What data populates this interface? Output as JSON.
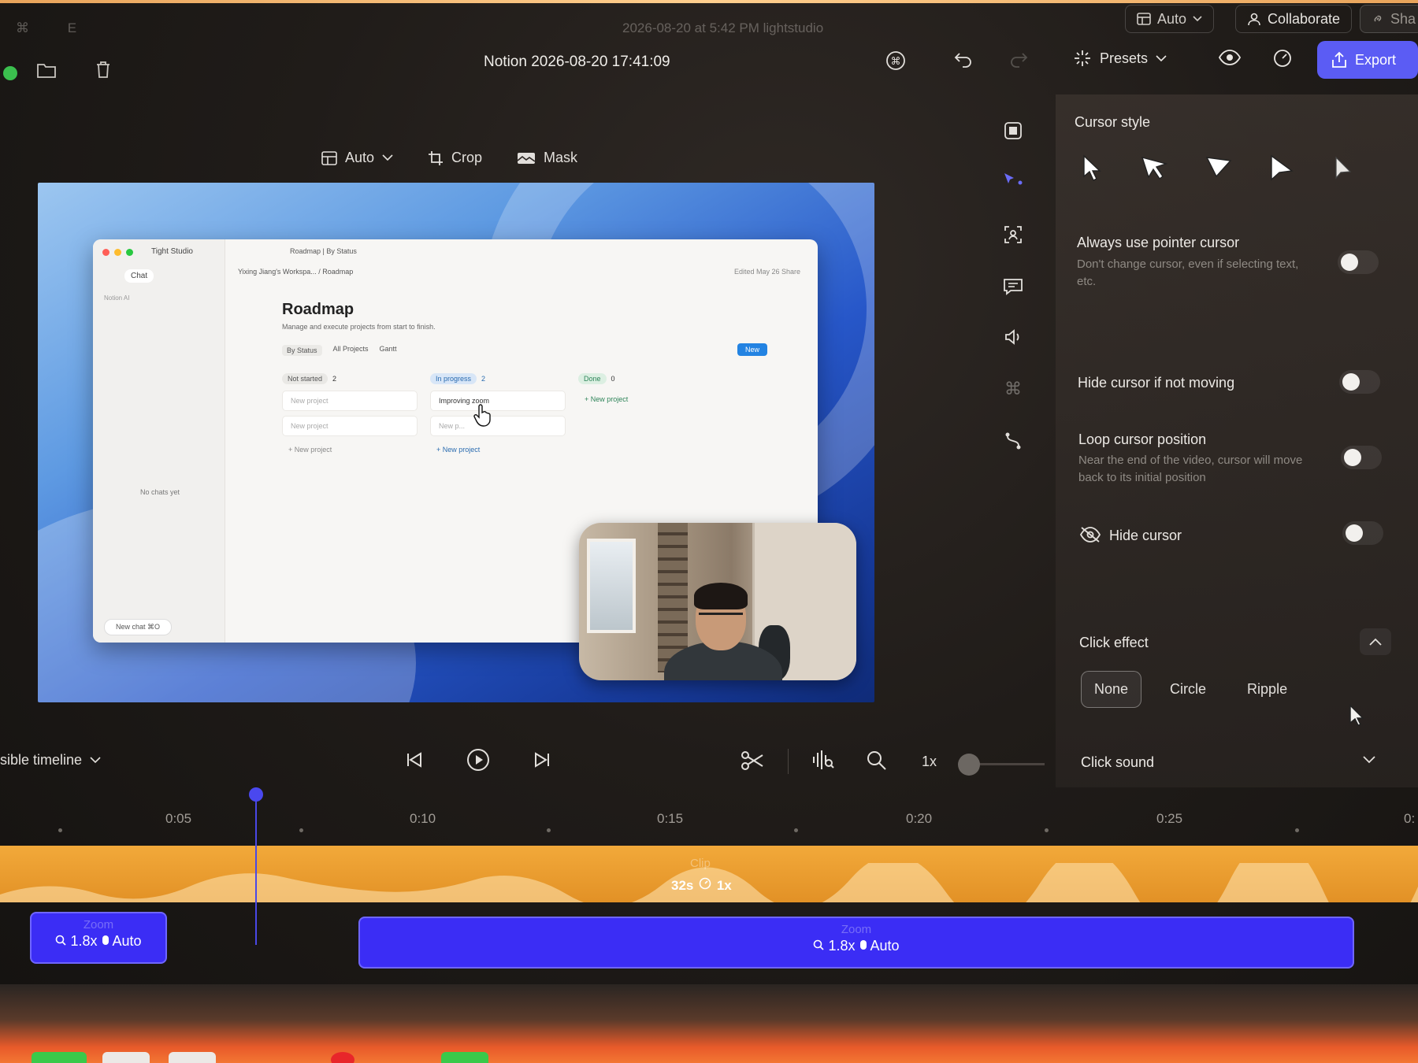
{
  "ghost_bar": {
    "date": "2026-08-20 at 5:42 PM lightstudio",
    "keys": "⌘   E"
  },
  "window_controls": {
    "auto_label": "Auto",
    "collaborate_label": "Collaborate",
    "share_label": "Sha"
  },
  "toolbar": {
    "title": "Notion 2026-08-20 17:41:09",
    "presets_label": "Presets",
    "export_label": "Export"
  },
  "edit_tools": {
    "auto": "Auto",
    "crop": "Crop",
    "mask": "Mask"
  },
  "preview_app": {
    "app_name": "Tight Studio",
    "tab_title": "Roadmap | By Status",
    "chat_label": "Chat",
    "notion_ai": "Notion AI",
    "no_chats": "No chats yet",
    "new_chat": "New chat  ⌘O",
    "breadcrumb": "Yixing Jiang's Workspa...  /  Roadmap",
    "edited": "Edited May 26    Share",
    "page_title": "Roadmap",
    "page_subtitle": "Manage and execute projects from start to finish.",
    "views": [
      "By Status",
      "All Projects",
      "Gantt"
    ],
    "new_button": "New",
    "columns": [
      {
        "name": "Not started",
        "count": "2",
        "cards": [
          "New project",
          "New project"
        ],
        "add": "+ New project"
      },
      {
        "name": "In progress",
        "count": "2",
        "cards": [
          "Improving zoom",
          "New p..."
        ],
        "add": "+ New project"
      },
      {
        "name": "Done",
        "count": "0",
        "cards": [],
        "add": "+ New project"
      }
    ]
  },
  "right_panel": {
    "cursor_style": "Cursor style",
    "always_pointer": "Always use pointer cursor",
    "always_pointer_desc": "Don't change cursor, even if selecting text, etc.",
    "hide_not_moving": "Hide cursor if not moving",
    "loop_position": "Loop cursor position",
    "loop_position_desc": "Near the end of the video, cursor will move back to its initial position",
    "hide_cursor": "Hide cursor",
    "click_effect": "Click effect",
    "effect_options": [
      "None",
      "Circle",
      "Ripple"
    ],
    "click_sound": "Click sound"
  },
  "playbar": {
    "visible_timeline": "sible timeline",
    "speed": "1x"
  },
  "ruler": {
    "ticks": [
      "0:05",
      "0:10",
      "0:15",
      "0:20",
      "0:25",
      "0:"
    ]
  },
  "clip": {
    "label": "Clip",
    "duration": "32s",
    "speed": "1x"
  },
  "zooms": [
    {
      "label": "Zoom",
      "scale": "1.8x",
      "mode": "Auto"
    },
    {
      "label": "Zoom",
      "scale": "1.8x",
      "mode": "Auto"
    }
  ],
  "colors": {
    "accent": "#5b5cf4",
    "clip": "#f2a93a",
    "zoom": "#3b2df5"
  }
}
